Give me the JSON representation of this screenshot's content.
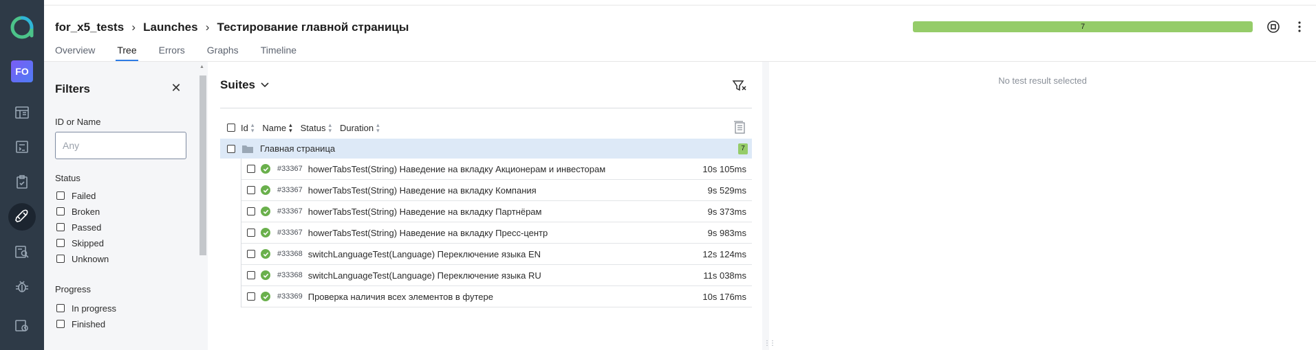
{
  "user": {
    "initials": "FO"
  },
  "breadcrumb": [
    "for_x5_tests",
    "Launches",
    "Тестирование главной страницы"
  ],
  "tabs": [
    {
      "label": "Overview",
      "active": false
    },
    {
      "label": "Tree",
      "active": true
    },
    {
      "label": "Errors",
      "active": false
    },
    {
      "label": "Graphs",
      "active": false
    },
    {
      "label": "Timeline",
      "active": false
    }
  ],
  "header": {
    "progress_label": "7",
    "passed_fraction": 1.0
  },
  "sidebar": {
    "icons": [
      "dashboards-icon",
      "test-cases-icon",
      "test-plans-icon",
      "launches-icon",
      "analytics-icon",
      "defects-icon",
      "jobs-icon"
    ],
    "active": "launches-icon"
  },
  "filters": {
    "title": "Filters",
    "id_label": "ID or Name",
    "search_placeholder": "Any",
    "status_label": "Status",
    "status_options": [
      "Failed",
      "Broken",
      "Passed",
      "Skipped",
      "Unknown"
    ],
    "progress_label": "Progress",
    "progress_options": [
      "In progress",
      "Finished"
    ]
  },
  "tree": {
    "title": "Suites",
    "columns": [
      "Id",
      "Name",
      "Status",
      "Duration"
    ],
    "group": {
      "name": "Главная страница",
      "count": "7"
    },
    "rows": [
      {
        "id": "#33367",
        "name": "howerTabsTest(String) Наведение на вкладку Акционерам и инвесторам",
        "duration": "10s 105ms"
      },
      {
        "id": "#33367",
        "name": "howerTabsTest(String) Наведение на вкладку Компания",
        "duration": "9s 529ms"
      },
      {
        "id": "#33367",
        "name": "howerTabsTest(String) Наведение на вкладку Партнёрам",
        "duration": "9s 373ms"
      },
      {
        "id": "#33367",
        "name": "howerTabsTest(String) Наведение на вкладку Пресс-центр",
        "duration": "9s 983ms"
      },
      {
        "id": "#33368",
        "name": "switchLanguageTest(Language) Переключение языка EN",
        "duration": "12s 124ms"
      },
      {
        "id": "#33368",
        "name": "switchLanguageTest(Language) Переключение языка RU",
        "duration": "11s 038ms"
      },
      {
        "id": "#33369",
        "name": "Проверка наличия всех элементов в футере",
        "duration": "10s 176ms"
      }
    ]
  },
  "detail": {
    "empty_text": "No test result selected"
  },
  "colors": {
    "accent": "#2c7be5",
    "passed": "#95cc69",
    "rail": "#2e3a47",
    "logo": "#4cc38a"
  }
}
